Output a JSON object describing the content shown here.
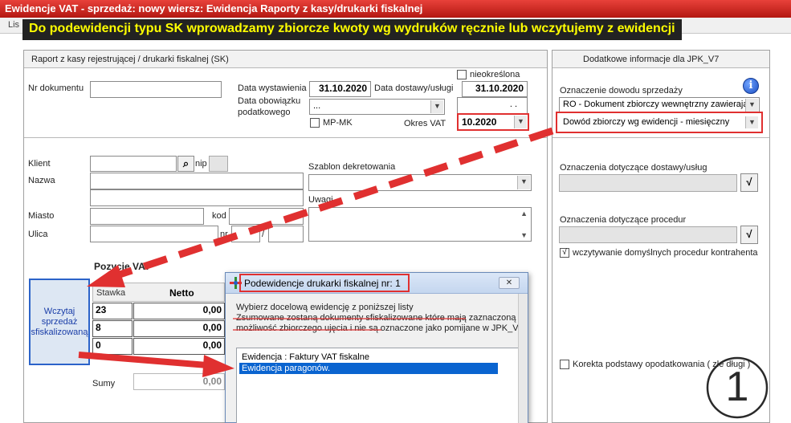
{
  "window": {
    "title": "Ewidencje VAT - sprzedaż: nowy wiersz: Ewidencja Raporty z kasy/drukarki fiskalnej",
    "tab_fragment": "Lis"
  },
  "banner": {
    "text": "Do podewidencji typu SK wprowadzamy zbiorcze kwoty wg wydruków ręcznie lub  wczytujemy z ewidencji"
  },
  "left_panel": {
    "header": "Raport z  kasy rejestrującej / drukarki fiskalnej  (SK)",
    "nieokreslona_label": "nieokreślona",
    "nr_dokumentu_label": "Nr dokumentu",
    "nr_dokumentu_value": "",
    "data_wystawienia_label": "Data wystawienia",
    "data_wystawienia_value": "31.10.2020",
    "data_dostawy_label": "Data dostawy/usługi",
    "data_dostawy_value": "31.10.2020",
    "data_obowiazku_label_1": "Data obowiązku",
    "data_obowiazku_label_2": "podatkowego",
    "data_obowiazku_value": "...",
    "date_mask": ". .",
    "mp_mk_label": "MP-MK",
    "okres_vat_label": "Okres VAT",
    "okres_vat_value": "10.2020"
  },
  "client": {
    "klient_label": "Klient",
    "nip_label": "nip",
    "nazwa_label": "Nazwa",
    "miasto_label": "Miasto",
    "kod_label": "kod",
    "ulica_label": "Ulica",
    "nr_label": "nr",
    "slash_label": "/",
    "szablon_label": "Szablon dekretowania",
    "uwagi_label": "Uwagi"
  },
  "positions": {
    "title": "Pozycje VAT",
    "col_stawka": "Stawka",
    "col_netto": "Netto",
    "rows": [
      {
        "stawka": "23",
        "netto": "0,00"
      },
      {
        "stawka": "8",
        "netto": "0,00"
      },
      {
        "stawka": "0",
        "netto": "0,00"
      }
    ],
    "sumy_label": "Sumy",
    "sumy_value": "0,00",
    "wczytaj_button": "Wczytaj sprzedaż sfiskalizowaną"
  },
  "right_panel": {
    "header": "Dodatkowe informacje dla JPK_V7",
    "oznaczenie_dowodu_label": "Oznaczenie dowodu sprzedaży",
    "oznaczenie_dowodu_value": "RO - Dokument zbiorczy wewnętrzny zawierając",
    "dowod_zbiorczy_value": "Dowód zbiorczy wg ewidencji - miesięczny",
    "dostawy_label": "Oznaczenia dotyczące dostawy/usług",
    "procedur_label": "Oznaczenia dotyczące procedur",
    "wczytywanie_label": "wczytywanie domyślnych procedur kontrahenta",
    "korekta_label": "Korekta podstawy opodatkowania  ( złe długi )",
    "check_glyph": "√",
    "info_glyph": "i"
  },
  "dialog": {
    "title": "Podewidencje drukarki fiskalnej nr: 1",
    "close": "✕",
    "line1": "Wybierz docelową ewidencję z poniższej listy",
    "line2": "Zsumowane zostaną dokumenty sfiskalizowane które mają zaznaczoną",
    "line3": "możliwość zbiorczego ujęcia i nie są oznaczone jako pomijane w JPK_V7",
    "items": [
      "Ewidencja : Faktury VAT fiskalne",
      "Ewidencja paragonów."
    ]
  },
  "annotation": {
    "step_number": "1"
  },
  "colors": {
    "title_red": "#c0201a",
    "banner_bg": "#222222",
    "banner_text": "#ffff00",
    "annotation_red": "#e03030",
    "selection_blue": "#0a64d0",
    "button_text_blue": "#1a3ea8"
  }
}
